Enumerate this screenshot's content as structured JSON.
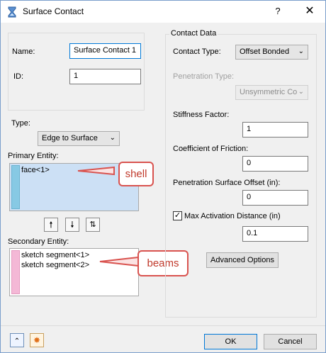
{
  "window": {
    "title": "Surface Contact",
    "help_label": "?",
    "close_label": "✕"
  },
  "left": {
    "name_label": "Name:",
    "name_value": "Surface Contact 1",
    "id_label": "ID:",
    "id_value": "1",
    "type_label": "Type:",
    "type_value": "Edge to Surface",
    "primary_label": "Primary Entity:",
    "primary_items": [
      "face<1>"
    ],
    "primary_color": "#87c9e4",
    "secondary_label": "Secondary Entity:",
    "secondary_items": [
      "sketch segment<1>",
      "sketch segment<2>"
    ],
    "secondary_color": "#f4b8d6",
    "move_up_icon": "arrow-up",
    "move_down_icon": "arrow-down",
    "swap_icon": "arrow-swap"
  },
  "contact_data": {
    "group_title": "Contact Data",
    "contact_type_label": "Contact Type:",
    "contact_type_value": "Offset Bonded",
    "penetration_type_label": "Penetration Type:",
    "penetration_type_value": "Unsymmetric Co",
    "stiffness_label": "Stiffness Factor:",
    "stiffness_value": "1",
    "friction_label": "Coefficient of Friction:",
    "friction_value": "0",
    "penetration_offset_label": "Penetration Surface Offset (in):",
    "penetration_offset_value": "0",
    "max_activation_label": "Max Activation Distance (in)",
    "max_activation_checked": true,
    "max_activation_value": "0.1",
    "advanced_label": "Advanced Options"
  },
  "annotations": {
    "shell": "shell",
    "beams": "beams"
  },
  "footer": {
    "ok_label": "OK",
    "cancel_label": "Cancel"
  }
}
